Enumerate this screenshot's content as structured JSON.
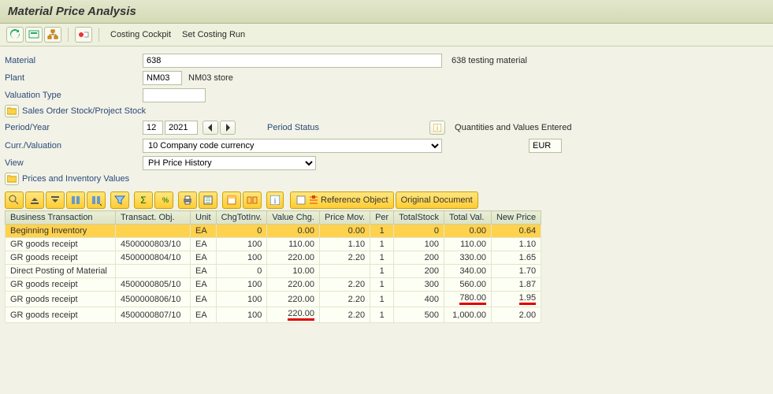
{
  "title": "Material Price Analysis",
  "toolbar": {
    "costing_cockpit": "Costing Cockpit",
    "set_costing_run": "Set Costing Run"
  },
  "form": {
    "material_lbl": "Material",
    "material_val": "638",
    "material_desc": "638 testing material",
    "plant_lbl": "Plant",
    "plant_val": "NM03",
    "plant_desc": "NM03 store",
    "valtype_lbl": "Valuation Type",
    "valtype_val": "",
    "sales_stock_toggle": "Sales Order Stock/Project Stock",
    "period_lbl": "Period/Year",
    "period_val": "12",
    "year_val": "2021",
    "period_status_lbl": "Period Status",
    "period_status_desc": "Quantities and Values Entered",
    "curr_lbl": "Curr./Valuation",
    "curr_val": "10 Company code currency",
    "curr_unit": "EUR",
    "view_lbl": "View",
    "view_val": "PH Price History",
    "prices_toggle": "Prices and Inventory Values"
  },
  "grid_buttons": {
    "ref_obj": "Reference Object",
    "orig_doc": "Original Document"
  },
  "columns": {
    "c0": "Business Transaction",
    "c1": "Transact. Obj.",
    "c2": "Unit",
    "c3": "ChgTotInv.",
    "c4": "Value Chg.",
    "c5": "Price Mov.",
    "c6": "Per",
    "c7": "TotalStock",
    "c8": "Total Val.",
    "c9": "New Price"
  },
  "rows": [
    {
      "bt": "Beginning Inventory",
      "to": "",
      "unit": "EA",
      "cti": "0",
      "vc": "0.00",
      "pm": "0.00",
      "per": "1",
      "ts": "0",
      "tv": "0.00",
      "np": "0.64",
      "hl": true
    },
    {
      "bt": "GR goods receipt",
      "to": "4500000803/10",
      "unit": "EA",
      "cti": "100",
      "vc": "110.00",
      "pm": "1.10",
      "per": "1",
      "ts": "100",
      "tv": "110.00",
      "np": "1.10"
    },
    {
      "bt": "GR goods receipt",
      "to": "4500000804/10",
      "unit": "EA",
      "cti": "100",
      "vc": "220.00",
      "pm": "2.20",
      "per": "1",
      "ts": "200",
      "tv": "330.00",
      "np": "1.65"
    },
    {
      "bt": "Direct Posting of Material",
      "to": "",
      "unit": "EA",
      "cti": "0",
      "vc": "10.00",
      "pm": "",
      "per": "1",
      "ts": "200",
      "tv": "340.00",
      "np": "1.70"
    },
    {
      "bt": "GR goods receipt",
      "to": "4500000805/10",
      "unit": "EA",
      "cti": "100",
      "vc": "220.00",
      "pm": "2.20",
      "per": "1",
      "ts": "300",
      "tv": "560.00",
      "np": "1.87"
    },
    {
      "bt": "GR goods receipt",
      "to": "4500000806/10",
      "unit": "EA",
      "cti": "100",
      "vc": "220.00",
      "pm": "2.20",
      "per": "1",
      "ts": "400",
      "tv": "780.00",
      "np": "1.95",
      "mark_tv": true,
      "mark_np": true
    },
    {
      "bt": "GR goods receipt",
      "to": "4500000807/10",
      "unit": "EA",
      "cti": "100",
      "vc": "220.00",
      "pm": "2.20",
      "per": "1",
      "ts": "500",
      "tv": "1,000.00",
      "np": "2.00",
      "mark_vc": true
    }
  ]
}
